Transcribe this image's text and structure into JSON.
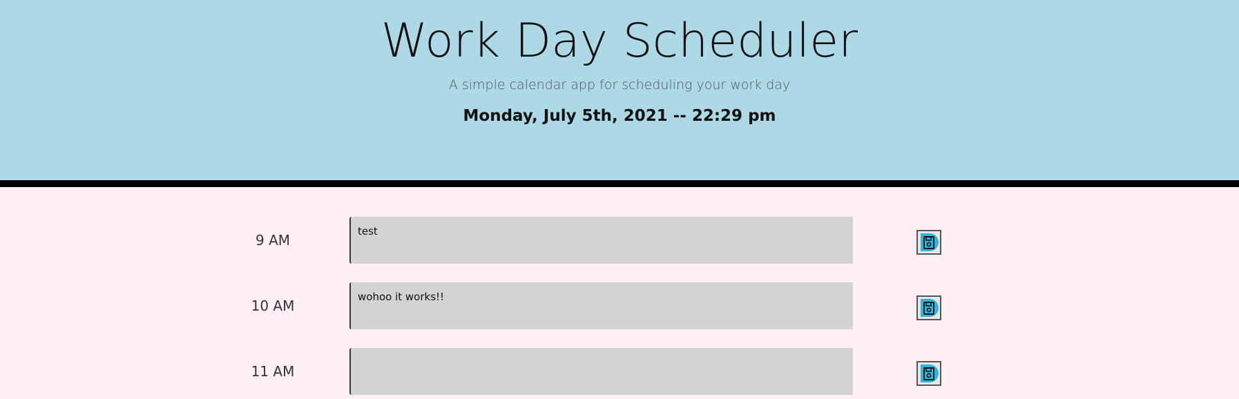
{
  "header": {
    "title": "Work Day Scheduler",
    "subtitle": "A simple calendar app for scheduling your work day",
    "current_day": "Monday, July 5th, 2021 -- 22:29 pm"
  },
  "schedule": [
    {
      "hour": "9 AM",
      "text": "test"
    },
    {
      "hour": "10 AM",
      "text": "wohoo it works!!"
    },
    {
      "hour": "11 AM",
      "text": ""
    }
  ],
  "icons": {
    "save": "save-icon"
  },
  "colors": {
    "header_bg": "#add8e6",
    "page_bg": "#fff0f5",
    "textarea_bg": "#d3d3d3",
    "save_icon_accent": "#29b6e0"
  }
}
